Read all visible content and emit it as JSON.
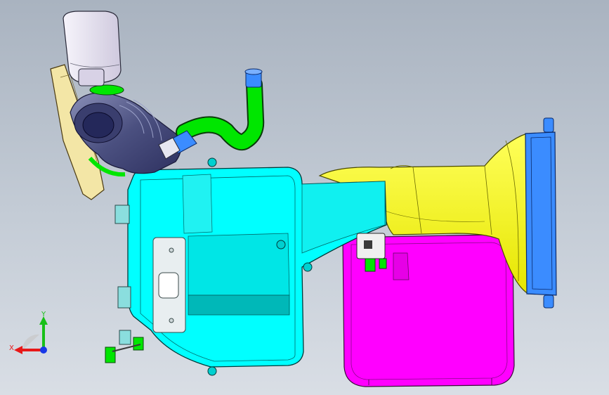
{
  "viewport": {
    "background_top": "#a9b3c0",
    "background_bottom": "#d9dee5"
  },
  "parts": {
    "filter_housing": {
      "color": "#00ffff"
    },
    "intake_duct": {
      "color": "#ffff00"
    },
    "resonator": {
      "color": "#ff00ff"
    },
    "inlet_hose": {
      "color": "#00e600"
    },
    "flange": {
      "color": "#2f7dff"
    },
    "bellows": {
      "color": "#5a5f8e"
    },
    "sensor_cap": {
      "color": "#e6e1f0"
    },
    "bracket": {
      "color": "#f3e6a6"
    }
  },
  "triad": {
    "x_label": "X",
    "y_label": "Y",
    "x_color": "#e81818",
    "y_color": "#18c018",
    "z_color": "#1838e8"
  }
}
